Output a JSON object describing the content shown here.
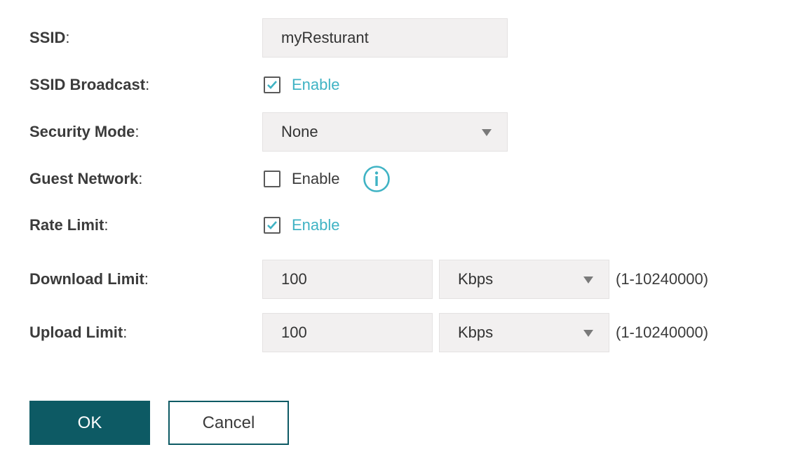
{
  "form": {
    "ssid": {
      "label": "SSID",
      "value": "myResturant"
    },
    "ssid_broadcast": {
      "label": "SSID Broadcast",
      "checked": true,
      "option_label": "Enable"
    },
    "security_mode": {
      "label": "Security Mode",
      "selected": "None"
    },
    "guest_network": {
      "label": "Guest Network",
      "checked": false,
      "option_label": "Enable",
      "info_icon": "info-circle-icon"
    },
    "rate_limit": {
      "label": "Rate Limit",
      "checked": true,
      "option_label": "Enable"
    },
    "download_limit": {
      "label": "Download Limit",
      "value": "100",
      "unit": "Kbps",
      "range": "(1-10240000)"
    },
    "upload_limit": {
      "label": "Upload Limit",
      "value": "100",
      "unit": "Kbps",
      "range": "(1-10240000)"
    }
  },
  "buttons": {
    "ok_label": "OK",
    "cancel_label": "Cancel"
  },
  "colors": {
    "accent": "#3fb3c4",
    "primary_button": "#0d5a64",
    "field_background": "#f2f0f0",
    "label_text": "#3b3b3b"
  }
}
